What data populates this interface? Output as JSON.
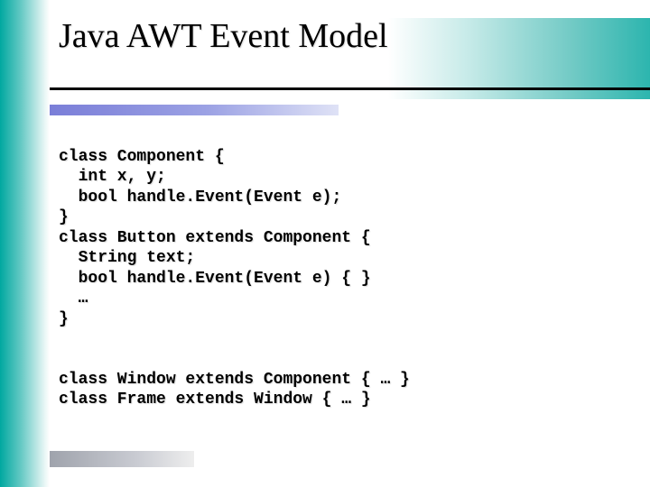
{
  "title": "Java AWT Event Model",
  "code": {
    "block1": "class Component {\n  int x, y;\n  bool handle.Event(Event e);\n}\nclass Button extends Component {\n  String text;\n  bool handle.Event(Event e) { }\n  …\n}",
    "block2": "class Window extends Component { … }\nclass Frame extends Window { … }"
  }
}
